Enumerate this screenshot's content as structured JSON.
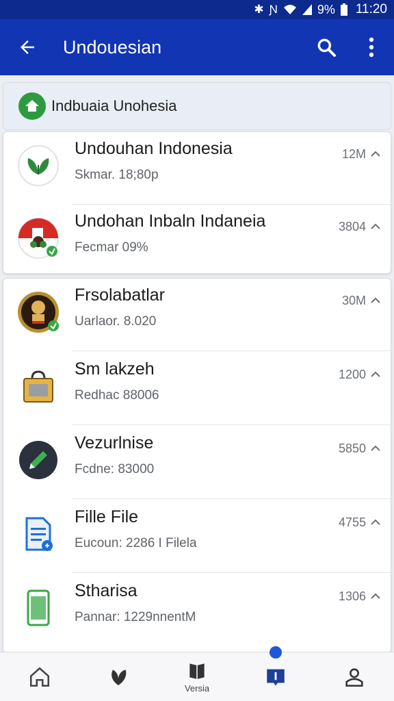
{
  "status_bar": {
    "battery_percent": "9%",
    "time": "11:20",
    "icons": [
      "bluetooth-icon",
      "nfc-icon",
      "wifi-icon",
      "signal-icon",
      "battery-icon"
    ]
  },
  "app_bar": {
    "title": "Undouesian",
    "back_icon": "arrow-left-icon",
    "search_icon": "search-icon",
    "more_icon": "more-vert-icon"
  },
  "banner": {
    "label": "Indbuaia Unohesia",
    "icon": "home-icon"
  },
  "groups": [
    {
      "items": [
        {
          "title": "Undouhan Indonesia",
          "subtitle": "Skmar. 18;80p",
          "size": "12M",
          "icon": "leaf-icon"
        },
        {
          "title": "Undohan Inbaln Indaneia",
          "subtitle": "Fecmar 09%",
          "size": "3804",
          "icon": "flag-icon"
        }
      ]
    },
    {
      "items": [
        {
          "title": "Frsolabatlar",
          "subtitle": "Uarlaor. 8.020",
          "size": "30M",
          "icon": "garuda-icon"
        },
        {
          "title": "Sm lakzeh",
          "subtitle": "Redhac 88006",
          "size": "1200",
          "icon": "bag-icon"
        },
        {
          "title": "Vezurlnise",
          "subtitle": "Fcdne: 83000",
          "size": "5850",
          "icon": "edit-icon"
        },
        {
          "title": "Fille File",
          "subtitle": "Eucoun: 2286 I Filela",
          "size": "4755",
          "icon": "document-icon"
        },
        {
          "title": "Stharisa",
          "subtitle": "Pannar: 1229nnentM",
          "size": "1306",
          "icon": "phone-icon"
        }
      ]
    }
  ],
  "bottom_nav": {
    "items": [
      {
        "label": "",
        "icon": "home-outline-icon"
      },
      {
        "label": "",
        "icon": "leaf-nav-icon"
      },
      {
        "label": "Versia",
        "icon": "book-icon"
      },
      {
        "label": "",
        "icon": "badge-icon",
        "active": true
      },
      {
        "label": "",
        "icon": "person-icon"
      }
    ]
  },
  "colors": {
    "status_bar": "#0d2a8e",
    "app_bar": "#1235b4",
    "accent_green": "#2e9a3f",
    "nav_dot": "#1f57d6"
  }
}
